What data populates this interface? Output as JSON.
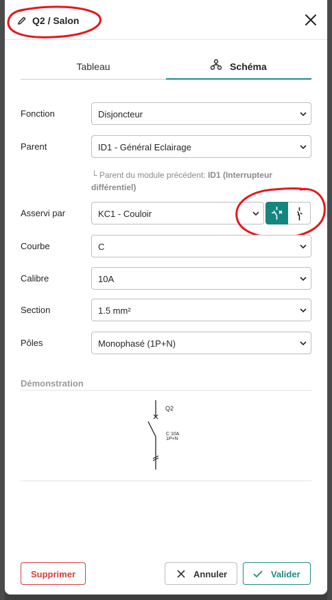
{
  "modal": {
    "title": "Q2 / Salon",
    "close_icon": "close-icon",
    "edit_icon": "pencil-icon"
  },
  "tabs": [
    {
      "label": "Tableau",
      "active": false
    },
    {
      "label": "Schéma",
      "active": true,
      "icon": "hierarchy-icon"
    }
  ],
  "form": {
    "fonction": {
      "label": "Fonction",
      "value": "Disjoncteur"
    },
    "parent": {
      "label": "Parent",
      "value": "ID1 - Général Eclairage"
    },
    "parent_hint": {
      "prefix": "└ Parent du module précédent: ",
      "bold": "ID1 (Interrupteur différentiel)"
    },
    "asservi": {
      "label": "Asservi par",
      "value": "KC1 - Couloir",
      "toggle": [
        {
          "icon": "switch-open-icon",
          "active": true
        },
        {
          "icon": "switch-closed-icon",
          "active": false
        }
      ]
    },
    "courbe": {
      "label": "Courbe",
      "value": "C"
    },
    "calibre": {
      "label": "Calibre",
      "value": "10A"
    },
    "section": {
      "label": "Section",
      "value": "1.5 mm²"
    },
    "poles": {
      "label": "Pôles",
      "value": "Monophasé (1P+N)"
    }
  },
  "demo": {
    "title": "Démonstration",
    "diagram": {
      "name": "Q2",
      "rating_line1": "C 10A",
      "rating_line2": "1P+N"
    }
  },
  "footer": {
    "delete_label": "Supprimer",
    "cancel_label": "Annuler",
    "validate_label": "Valider"
  },
  "colors": {
    "accent": "#14857f",
    "danger": "#d93b3b",
    "annotation": "#e8151b"
  }
}
